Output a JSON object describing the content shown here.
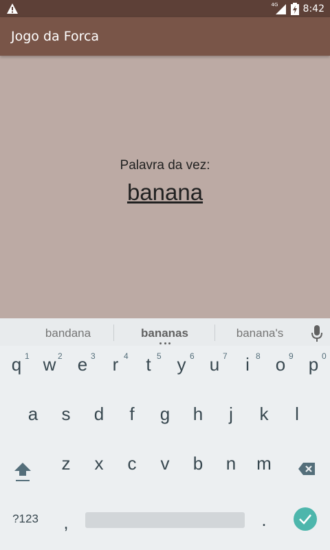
{
  "status_bar": {
    "time": "8:42",
    "network": "4G",
    "icons": [
      "warning-icon",
      "signal-icon",
      "battery-icon"
    ]
  },
  "app_bar": {
    "title": "Jogo da Forca"
  },
  "main": {
    "label": "Palavra da vez:",
    "word": "banana"
  },
  "keyboard": {
    "suggestions": [
      "bandana",
      "bananas",
      "banana's"
    ],
    "row1": [
      {
        "key": "q",
        "hint": "1"
      },
      {
        "key": "w",
        "hint": "2"
      },
      {
        "key": "e",
        "hint": "3"
      },
      {
        "key": "r",
        "hint": "4"
      },
      {
        "key": "t",
        "hint": "5"
      },
      {
        "key": "y",
        "hint": "6"
      },
      {
        "key": "u",
        "hint": "7"
      },
      {
        "key": "i",
        "hint": "8"
      },
      {
        "key": "o",
        "hint": "9"
      },
      {
        "key": "p",
        "hint": "0"
      }
    ],
    "row2": [
      "a",
      "s",
      "d",
      "f",
      "g",
      "h",
      "j",
      "k",
      "l"
    ],
    "row3": [
      "z",
      "x",
      "c",
      "v",
      "b",
      "n",
      "m"
    ],
    "symbols_key": "?123",
    "comma_key": ",",
    "period_key": ".",
    "accent_color": "#4db6ac"
  }
}
